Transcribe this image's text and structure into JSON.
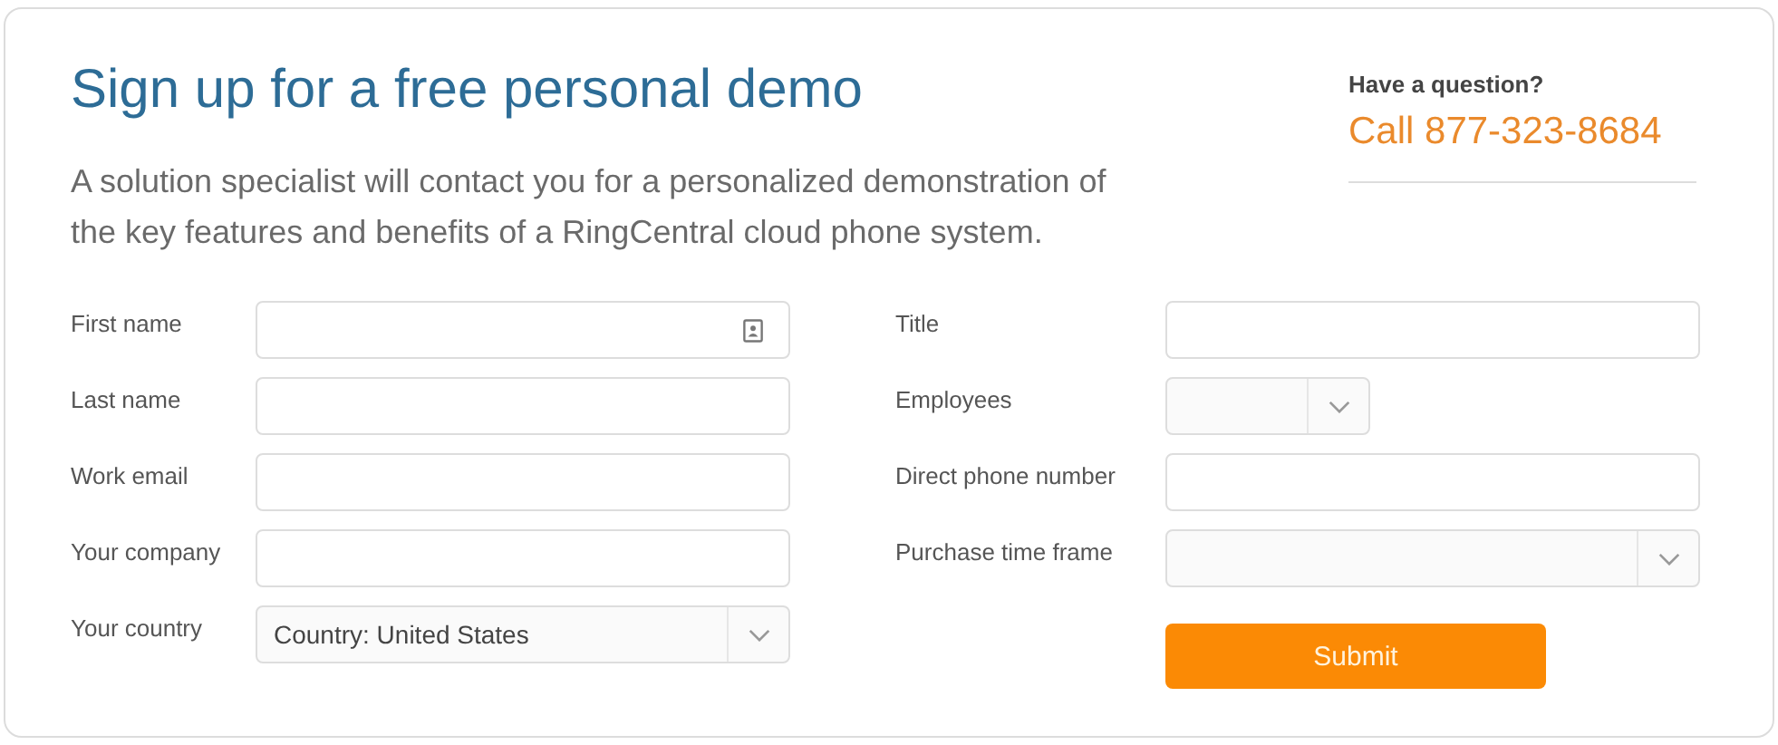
{
  "title": "Sign up for a free personal demo",
  "description": "A solution specialist will contact you for a personalized demonstration of the key features and benefits of a RingCentral cloud phone system.",
  "contact": {
    "prompt": "Have a question?",
    "phone": "Call 877-323-8684"
  },
  "form": {
    "left_fields": [
      {
        "label": "First name",
        "kind": "text-contact"
      },
      {
        "label": "Last name",
        "kind": "text"
      },
      {
        "label": "Work email",
        "kind": "text"
      },
      {
        "label": "Your company",
        "kind": "text"
      },
      {
        "label": "Your country",
        "kind": "select",
        "value": "Country: United States"
      }
    ],
    "right_fields": [
      {
        "label": "Title",
        "kind": "text"
      },
      {
        "label": "Employees",
        "kind": "select-short"
      },
      {
        "label": "Direct phone number",
        "kind": "text"
      },
      {
        "label": "Purchase time frame",
        "kind": "select"
      }
    ],
    "submit": "Submit"
  }
}
